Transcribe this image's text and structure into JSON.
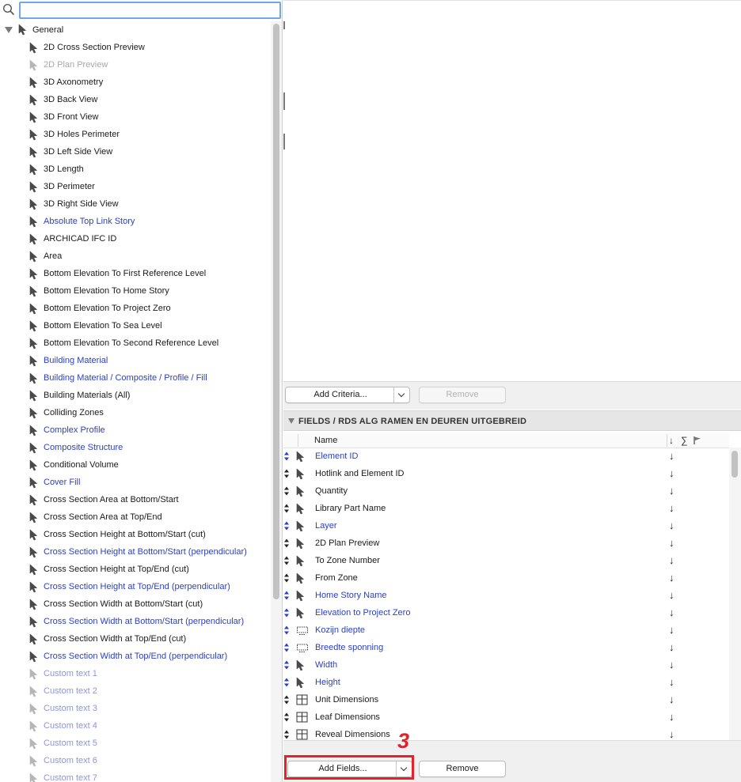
{
  "search": {
    "value": "",
    "placeholder": ""
  },
  "tree": {
    "root_label": "General",
    "items": [
      {
        "label": "2D Cross Section Preview",
        "style": "normal"
      },
      {
        "label": "2D Plan Preview",
        "style": "gray"
      },
      {
        "label": "3D Axonometry",
        "style": "normal"
      },
      {
        "label": "3D Back View",
        "style": "normal"
      },
      {
        "label": "3D Front View",
        "style": "normal"
      },
      {
        "label": "3D Holes Perimeter",
        "style": "normal"
      },
      {
        "label": "3D Left Side View",
        "style": "normal"
      },
      {
        "label": "3D Length",
        "style": "normal"
      },
      {
        "label": "3D Perimeter",
        "style": "normal"
      },
      {
        "label": "3D Right Side View",
        "style": "normal"
      },
      {
        "label": "Absolute Top Link Story",
        "style": "blue"
      },
      {
        "label": "ARCHICAD IFC ID",
        "style": "normal"
      },
      {
        "label": "Area",
        "style": "normal"
      },
      {
        "label": "Bottom Elevation To First Reference Level",
        "style": "normal"
      },
      {
        "label": "Bottom Elevation To Home Story",
        "style": "normal"
      },
      {
        "label": "Bottom Elevation To Project Zero",
        "style": "normal"
      },
      {
        "label": "Bottom Elevation To Sea Level",
        "style": "normal"
      },
      {
        "label": "Bottom Elevation To Second Reference Level",
        "style": "normal"
      },
      {
        "label": "Building Material",
        "style": "blue"
      },
      {
        "label": "Building Material / Composite / Profile / Fill",
        "style": "blue"
      },
      {
        "label": "Building Materials (All)",
        "style": "normal"
      },
      {
        "label": "Colliding Zones",
        "style": "normal"
      },
      {
        "label": "Complex Profile",
        "style": "blue"
      },
      {
        "label": "Composite Structure",
        "style": "blue"
      },
      {
        "label": "Conditional Volume",
        "style": "normal"
      },
      {
        "label": "Cover Fill",
        "style": "blue"
      },
      {
        "label": "Cross Section Area at Bottom/Start",
        "style": "normal"
      },
      {
        "label": "Cross Section Area at Top/End",
        "style": "normal"
      },
      {
        "label": "Cross Section Height at Bottom/Start (cut)",
        "style": "normal"
      },
      {
        "label": "Cross Section Height at Bottom/Start (perpendicular)",
        "style": "blue"
      },
      {
        "label": "Cross Section Height at Top/End (cut)",
        "style": "normal"
      },
      {
        "label": "Cross Section Height at Top/End (perpendicular)",
        "style": "blue"
      },
      {
        "label": "Cross Section Width at Bottom/Start (cut)",
        "style": "normal"
      },
      {
        "label": "Cross Section Width at Bottom/Start (perpendicular)",
        "style": "blue"
      },
      {
        "label": "Cross Section Width at Top/End (cut)",
        "style": "normal"
      },
      {
        "label": "Cross Section Width at Top/End (perpendicular)",
        "style": "blue"
      },
      {
        "label": "Custom text  1",
        "style": "lightblue"
      },
      {
        "label": "Custom text  2",
        "style": "lightblue"
      },
      {
        "label": "Custom text  3",
        "style": "lightblue"
      },
      {
        "label": "Custom text  4",
        "style": "lightblue"
      },
      {
        "label": "Custom text  5",
        "style": "lightblue"
      },
      {
        "label": "Custom text  6",
        "style": "lightblue"
      },
      {
        "label": "Custom text  7",
        "style": "lightblue"
      }
    ]
  },
  "criteria_toolbar": {
    "add_criteria_label": "Add Criteria...",
    "remove_label": "Remove"
  },
  "fields": {
    "section_title": "FIELDS / RDS ALG RAMEN EN DEUREN UITGEBREID",
    "name_column": "Name",
    "sort_icon": "↓",
    "sum_icon": "∑",
    "flag_icon": "flag-icon",
    "rows": [
      {
        "label": "Element ID",
        "style": "blue",
        "icon": "cursor-icon",
        "sort": "↓"
      },
      {
        "label": "Hotlink and Element ID",
        "style": "normal",
        "icon": "cursor-icon",
        "sort": "↓"
      },
      {
        "label": "Quantity",
        "style": "normal",
        "icon": "cursor-icon",
        "sort": "↓"
      },
      {
        "label": "Library Part Name",
        "style": "normal",
        "icon": "cursor-icon",
        "sort": "↓"
      },
      {
        "label": "Layer",
        "style": "blue",
        "icon": "cursor-icon",
        "sort": "↓"
      },
      {
        "label": "2D Plan Preview",
        "style": "normal",
        "icon": "cursor-icon",
        "sort": "↓"
      },
      {
        "label": "To Zone Number",
        "style": "normal",
        "icon": "cursor-icon",
        "sort": "↓"
      },
      {
        "label": "From Zone",
        "style": "normal",
        "icon": "cursor-icon",
        "sort": "↓"
      },
      {
        "label": "Home Story Name",
        "style": "blue",
        "icon": "cursor-icon",
        "sort": "↓"
      },
      {
        "label": "Elevation to Project Zero",
        "style": "blue",
        "icon": "cursor-icon",
        "sort": "↓"
      },
      {
        "label": "Kozijn diepte",
        "style": "blue",
        "icon": "dashed-rect-icon",
        "sort": "↓"
      },
      {
        "label": "Breedte sponning",
        "style": "blue",
        "icon": "dashed-rect-icon",
        "sort": "↓"
      },
      {
        "label": "Width",
        "style": "blue",
        "icon": "cursor-icon",
        "sort": "↓"
      },
      {
        "label": "Height",
        "style": "blue",
        "icon": "cursor-icon",
        "sort": "↓"
      },
      {
        "label": "Unit Dimensions",
        "style": "normal",
        "icon": "window-icon",
        "sort": "↓"
      },
      {
        "label": "Leaf Dimensions",
        "style": "normal",
        "icon": "window-icon",
        "sort": "↓"
      },
      {
        "label": "Reveal Dimensions",
        "style": "normal",
        "icon": "window-icon",
        "sort": "↓"
      }
    ]
  },
  "fields_toolbar": {
    "add_fields_label": "Add Fields...",
    "remove_label": "Remove"
  },
  "annotation": {
    "number": "3",
    "color": "#e8202a"
  },
  "colors": {
    "link_blue": "#2a3fc4",
    "focus_blue": "#6ea8e8"
  }
}
